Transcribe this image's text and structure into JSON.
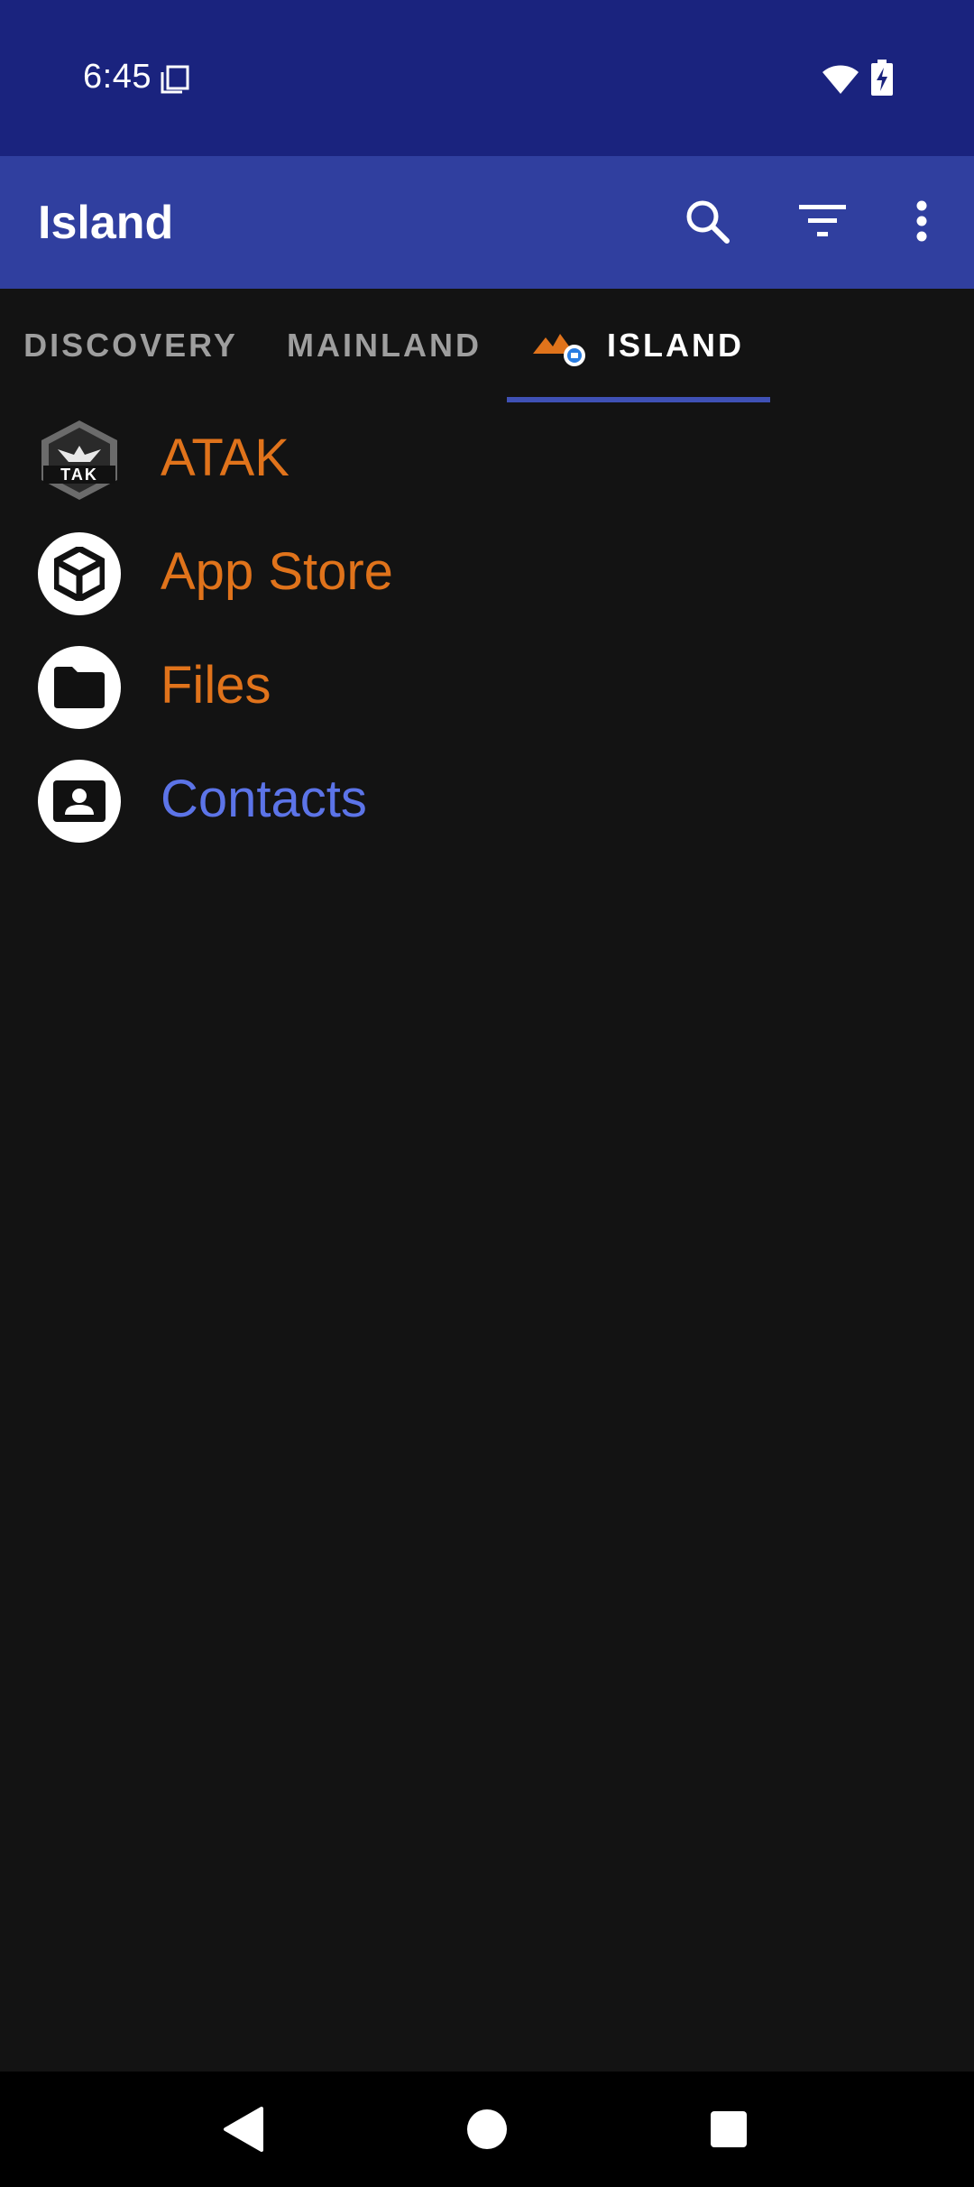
{
  "status_bar": {
    "time": "6:45",
    "icons": [
      "screenshot-icon",
      "wifi-icon",
      "battery-charging-icon"
    ]
  },
  "app_bar": {
    "title": "Island",
    "actions": [
      "search-icon",
      "filter-icon",
      "more-vert-icon"
    ]
  },
  "tabs": [
    {
      "label": "DISCOVERY",
      "selected": false
    },
    {
      "label": "MAINLAND",
      "selected": false
    },
    {
      "label": "ISLAND",
      "selected": true
    }
  ],
  "apps": [
    {
      "label": "ATAK",
      "icon": "tak-shield-icon",
      "color": "#e0731b"
    },
    {
      "label": "App Store",
      "icon": "package-cube-icon",
      "color": "#e0731b"
    },
    {
      "label": "Files",
      "icon": "folder-icon",
      "color": "#e0731b"
    },
    {
      "label": "Contacts",
      "icon": "contact-card-icon",
      "color": "#5c74e8"
    }
  ],
  "colors": {
    "status_bar": "#1a237e",
    "app_bar": "#303f9f",
    "accent_orange": "#e0731b",
    "accent_blue": "#5c74e8",
    "background": "#131313"
  },
  "nav_bar": {
    "buttons": [
      "back-icon",
      "home-icon",
      "recents-icon"
    ]
  }
}
